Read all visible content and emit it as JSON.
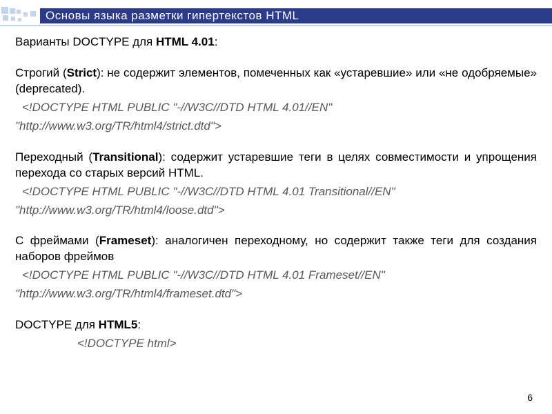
{
  "header": {
    "title": "Основы языка разметки гипертекстов HTML"
  },
  "intro": {
    "prefix": "Варианты DOCTYPE для ",
    "bold": "HTML 4.01",
    "suffix": ":"
  },
  "strict": {
    "label_prefix": "Строгий (",
    "label_bold": "Strict",
    "label_suffix": "): не содержит элементов, помеченных как «устаревшие» или «не одобряемые» (deprecated).",
    "code1": "<!DOCTYPE HTML PUBLIC \"-//W3C//DTD HTML 4.01//EN\"",
    "code2": "\"http://www.w3.org/TR/html4/strict.dtd\">"
  },
  "transitional": {
    "label_prefix": "Переходный (",
    "label_bold": "Transitional",
    "label_suffix": "): содержит устаревшие теги в целях совместимости и упрощения перехода со старых версий HTML.",
    "code1": "<!DOCTYPE HTML PUBLIC \"-//W3C//DTD HTML 4.01 Transitional//EN\"",
    "code2": "\"http://www.w3.org/TR/html4/loose.dtd\">"
  },
  "frameset": {
    "label_prefix": "С фреймами (",
    "label_bold": "Frameset",
    "label_suffix": "): аналогичен переходному, но содержит также теги для создания наборов фреймов",
    "code1": "<!DOCTYPE HTML PUBLIC \"-//W3C//DTD HTML 4.01 Frameset//EN\"",
    "code2": "\"http://www.w3.org/TR/html4/frameset.dtd\">"
  },
  "html5": {
    "label_prefix": "DOCTYPE для ",
    "label_bold": "HTML5",
    "label_suffix": ":",
    "code": "<!DOCTYPE html>"
  },
  "page_number": "6"
}
